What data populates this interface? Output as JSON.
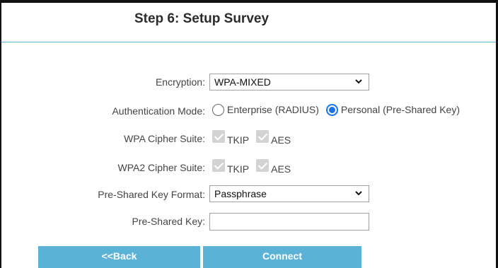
{
  "title": "Step 6: Setup Survey",
  "fields": {
    "encryption": {
      "label": "Encryption:",
      "value": "WPA-MIXED"
    },
    "auth_mode": {
      "label": "Authentication Mode:",
      "options": [
        {
          "label": "Enterprise (RADIUS)",
          "selected": false
        },
        {
          "label": "Personal (Pre-Shared Key)",
          "selected": true
        }
      ]
    },
    "wpa_cipher": {
      "label": "WPA Cipher Suite:",
      "options": [
        "TKIP",
        "AES"
      ]
    },
    "wpa2_cipher": {
      "label": "WPA2 Cipher Suite:",
      "options": [
        "TKIP",
        "AES"
      ]
    },
    "psk_format": {
      "label": "Pre-Shared Key Format:",
      "value": "Passphrase"
    },
    "psk": {
      "label": "Pre-Shared Key:",
      "value": ""
    }
  },
  "buttons": {
    "back": "<<Back",
    "connect": "Connect"
  },
  "colors": {
    "accent": "#5ab3d6",
    "radio": "#1a73e8",
    "checkbox_disabled": "#d3d3d3"
  },
  "icons": [
    "chevron-down-icon",
    "radio-icon",
    "checkbox-icon"
  ]
}
